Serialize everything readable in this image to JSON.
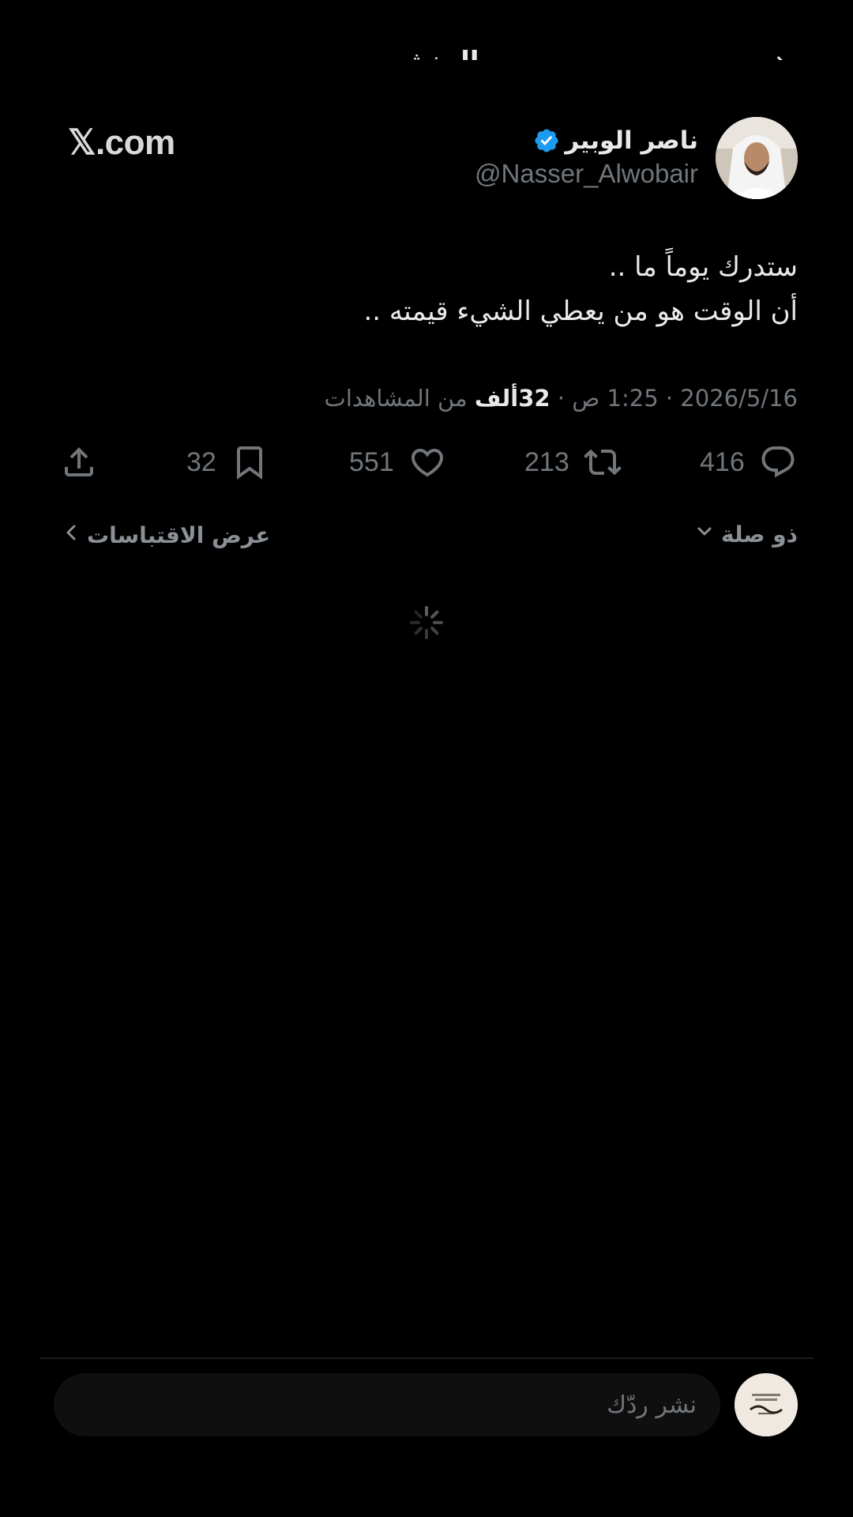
{
  "header": {
    "title_cut": "المنشور",
    "back_glyph": "→"
  },
  "watermark": "𝕏.com",
  "author": {
    "name": "ناصر الوبير",
    "handle": "@Nasser_Alwobair",
    "verified": true
  },
  "tweet": {
    "line1": "ستدرك يوماً ما ..",
    "line2": "أن الوقت هو من يعطي الشيء قيمته .."
  },
  "meta": {
    "date": "2026/5/16",
    "separator": " · ",
    "time": "1:25 ص",
    "views_count": "32ألف",
    "views_label": "من المشاهدات"
  },
  "actions": {
    "replies": "416",
    "reposts": "213",
    "likes": "551",
    "bookmarks": "32"
  },
  "related": {
    "sort_label": "ذو صلة",
    "quotes_label": "عرض الاقتباسات"
  },
  "reply": {
    "placeholder": "نشر ردّك"
  },
  "colors": {
    "background": "#000000",
    "text": "#e7e9ea",
    "muted": "#71767b",
    "verified": "#1d9bf0"
  }
}
